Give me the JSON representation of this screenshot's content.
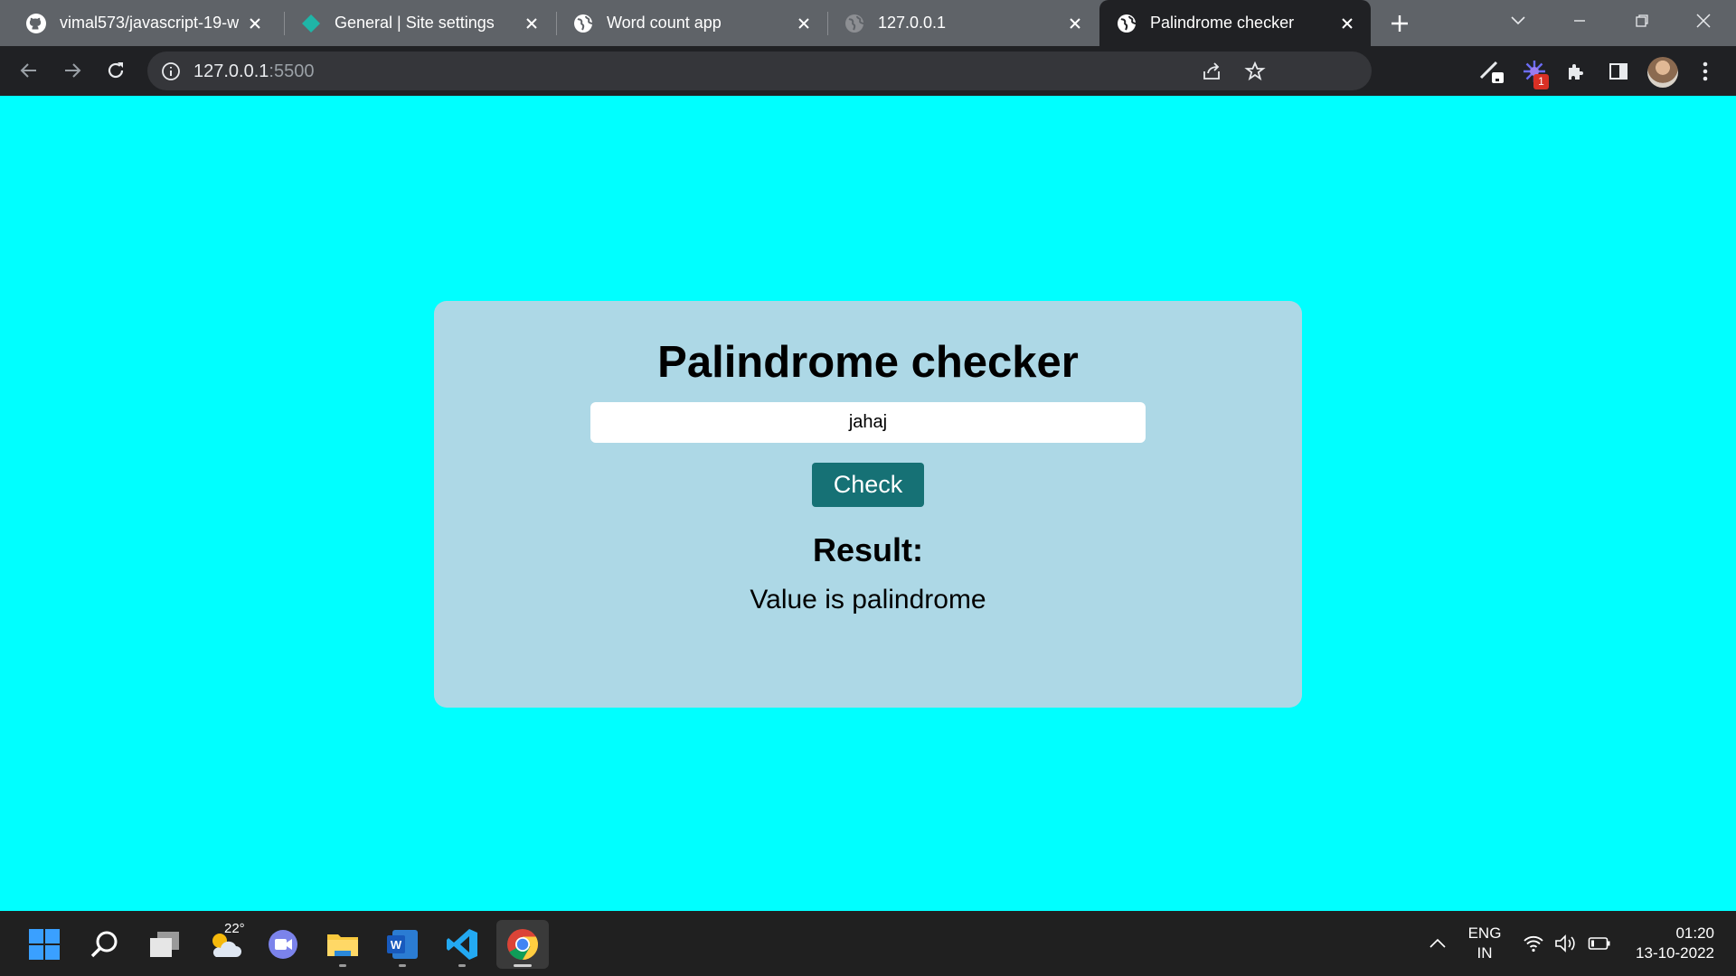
{
  "browser": {
    "tabs": [
      {
        "title": "vimal573/javascript-19-w",
        "icon": "github-icon",
        "active": false
      },
      {
        "title": "General | Site settings",
        "icon": "diamond-icon",
        "active": false
      },
      {
        "title": "Word count app",
        "icon": "globe-icon",
        "active": false
      },
      {
        "title": "127.0.0.1",
        "icon": "globe-icon",
        "active": false
      },
      {
        "title": "Palindrome checker",
        "icon": "globe-icon",
        "active": true
      }
    ],
    "address": {
      "host": "127.0.0.1",
      "port": ":5500"
    },
    "extension_badge": "1"
  },
  "app": {
    "heading": "Palindrome checker",
    "input_value": "jahaj",
    "check_label": "Check",
    "result_heading": "Result:",
    "result_text": "Value is palindrome"
  },
  "taskbar": {
    "weather_temp": "22°",
    "apps": [
      "start-icon",
      "search-icon",
      "task-view-icon",
      "weather-icon",
      "teams-chat-icon",
      "file-explorer-icon",
      "word-icon",
      "vscode-icon",
      "chrome-icon"
    ],
    "language_line1": "ENG",
    "language_line2": "IN",
    "time": "01:20",
    "date": "13-10-2022"
  },
  "colors": {
    "page_background": "#00ffff",
    "card_background": "#add8e6",
    "button_background": "#167175",
    "tabstrip": "#5f6368",
    "toolbar": "#202124",
    "taskbar": "#202020"
  }
}
